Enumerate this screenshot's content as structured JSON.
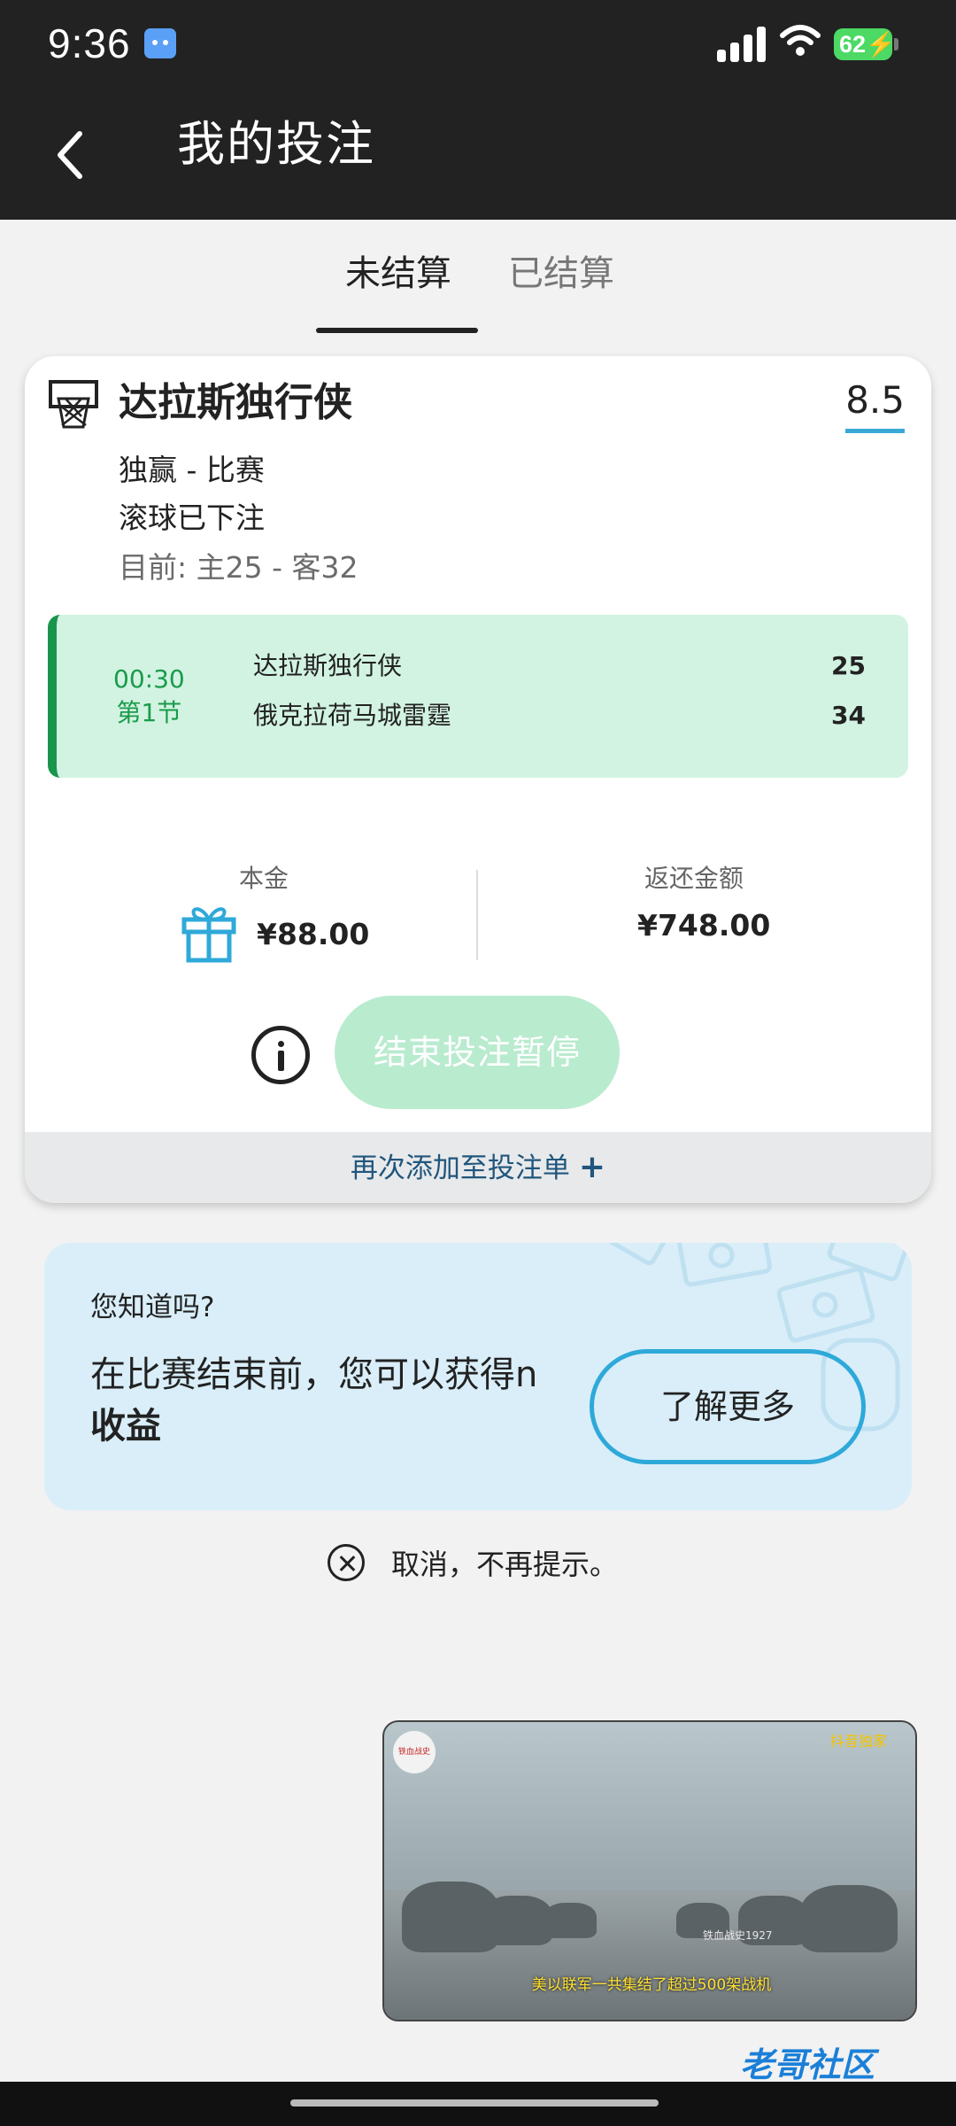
{
  "status_bar": {
    "time": "9:36",
    "battery": "62"
  },
  "header": {
    "title": "我的投注"
  },
  "tabs": [
    {
      "label": "未结算",
      "active": true
    },
    {
      "label": "已结算",
      "active": false
    }
  ],
  "bet": {
    "team": "达拉斯独行侠",
    "odds": "8.5",
    "market": "独赢 - 比赛",
    "bet_type": "滚球已下注",
    "current_score": "目前: 主25 - 客32",
    "live": {
      "clock": "00:30",
      "period": "第1节",
      "home_team": "达拉斯独行侠",
      "home_score": "25",
      "away_team": "俄克拉荷马城雷霆",
      "away_score": "34"
    },
    "stake_label": "本金",
    "stake_value": "¥88.00",
    "return_label": "返还金额",
    "return_value": "¥748.00",
    "cashout_label": "结束投注暂停",
    "readd_label": "再次添加至投注单",
    "readd_icon": "+"
  },
  "promo": {
    "question": "您知道吗?",
    "text_regular": "在比赛结束前，您可以获得n",
    "text_bold": "收益",
    "button": "了解更多"
  },
  "dismiss": {
    "label": "取消，不再提示。"
  },
  "video": {
    "channel_logo": "铁血战史",
    "tag": "抖音独家",
    "watermark": "铁血战史1927",
    "caption": "美以联军一共集结了超过500架战机"
  },
  "corner_logo": "老哥社区",
  "colors": {
    "accent_blue": "#2ea9d9",
    "live_green": "#19964c",
    "live_bg": "#d2f3e2",
    "header_bg": "#222222"
  }
}
